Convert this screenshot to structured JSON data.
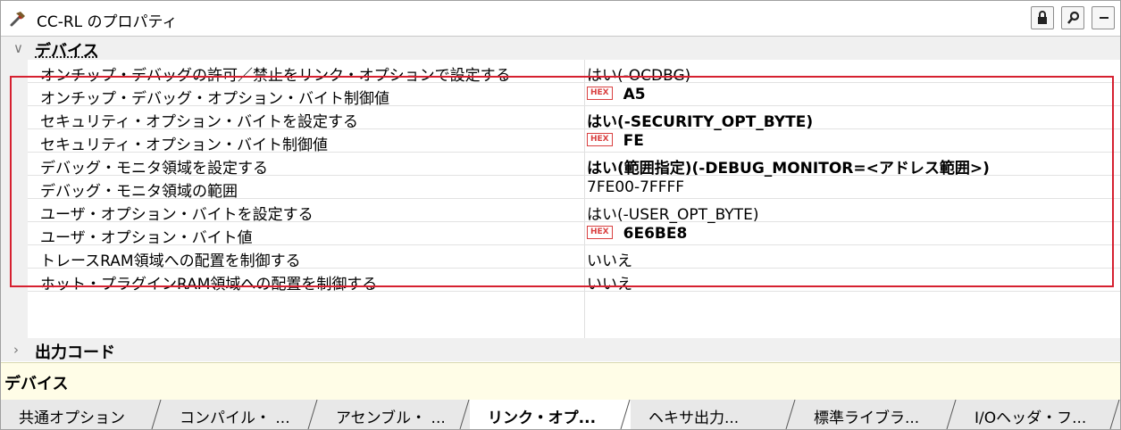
{
  "window": {
    "title": "CC-RL のプロパティ",
    "buttons": [
      "lock-icon",
      "search-icon",
      "minimize-icon"
    ]
  },
  "categories": [
    {
      "label": "デバイス",
      "expanded": true,
      "rows": [
        {
          "name": "オンチップ・デバッグの許可／禁止をリンク・オプションで設定する",
          "value": "はい(-OCDBG)",
          "bold": false,
          "hex": false
        },
        {
          "name": "オンチップ・デバッグ・オプション・バイト制御値",
          "value": "A5",
          "bold": true,
          "hex": true
        },
        {
          "name": "セキュリティ・オプション・バイトを設定する",
          "value": "はい(-SECURITY_OPT_BYTE)",
          "bold": true,
          "hex": false
        },
        {
          "name": "セキュリティ・オプション・バイト制御値",
          "value": "FE",
          "bold": true,
          "hex": true
        },
        {
          "name": "デバッグ・モニタ領域を設定する",
          "value": "はい(範囲指定)(-DEBUG_MONITOR=<アドレス範囲>)",
          "bold": true,
          "hex": false
        },
        {
          "name": "デバッグ・モニタ領域の範囲",
          "value": "7FE00-7FFFF",
          "bold": false,
          "hex": false
        },
        {
          "name": "ユーザ・オプション・バイトを設定する",
          "value": "はい(-USER_OPT_BYTE)",
          "bold": false,
          "hex": false
        },
        {
          "name": "ユーザ・オプション・バイト値",
          "value": "6E6BE8",
          "bold": true,
          "hex": true
        },
        {
          "name": "トレースRAM領域への配置を制御する",
          "value": "いいえ",
          "bold": false,
          "hex": false
        },
        {
          "name": "ホット・プラグインRAM領域への配置を制御する",
          "value": "いいえ",
          "bold": false,
          "hex": false
        }
      ]
    },
    {
      "label": "出力コード",
      "expanded": false,
      "rows": []
    }
  ],
  "hex_badge": "HEX",
  "description": {
    "title": "デバイス"
  },
  "tabs": [
    {
      "label": "共通オプション",
      "active": false
    },
    {
      "label": "コンパイル・ ...",
      "active": false
    },
    {
      "label": "アセンブル・ ...",
      "active": false
    },
    {
      "label": "リンク・オプ...",
      "active": true
    },
    {
      "label": "ヘキサ出力...",
      "active": false
    },
    {
      "label": "標準ライブラ...",
      "active": false
    },
    {
      "label": "I/Oヘッダ・フ...",
      "active": false
    }
  ],
  "colors": {
    "highlight_border": "#d62030",
    "hex_badge": "#d94040",
    "description_bg": "#fffde7"
  }
}
